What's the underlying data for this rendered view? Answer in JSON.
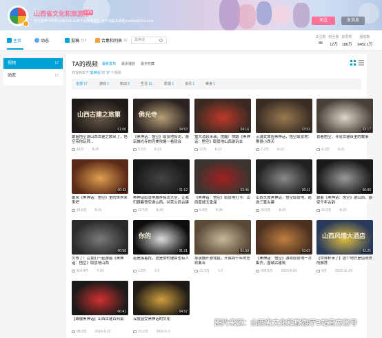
{
  "header": {
    "username": "山西省文化和旅游厅",
    "level": "LV6",
    "signature": "务注宣传守好地大美山西  山西文旅发布官方  合作请联系邮箱sxwhlyt@163.com",
    "follow_label": "关注",
    "message_label": "发消息"
  },
  "nav": {
    "items": [
      {
        "label": "主页",
        "count": ""
      },
      {
        "label": "动态",
        "count": ""
      },
      {
        "label": "投稿",
        "count": "613"
      },
      {
        "label": "合集和列表",
        "count": "22"
      }
    ],
    "search_value": "黑神话",
    "stats": [
      {
        "label": "关注数",
        "value": "86"
      },
      {
        "label": "粉丝数",
        "value": "12万"
      },
      {
        "label": "获赞数",
        "value": "186万"
      },
      {
        "label": "播放数",
        "value": "1482.1万"
      }
    ]
  },
  "sidebar": {
    "items": [
      {
        "label": "视频",
        "count": "17"
      },
      {
        "label": "动态",
        "count": "17"
      }
    ]
  },
  "main": {
    "title": "TA的视频",
    "sort_tabs": [
      "最新发布",
      "最多播放",
      "最多收藏"
    ],
    "result_prefix": "共找到关于“",
    "result_keyword": "黑神话",
    "result_mid": "”的 ",
    "result_count": "17",
    "result_suffix": " 个视频",
    "filters": [
      {
        "label": "全部",
        "count": "17"
      },
      {
        "label": "游戏",
        "count": "1"
      },
      {
        "label": "知识",
        "count": "2"
      },
      {
        "label": "生活",
        "count": "11"
      },
      {
        "label": "影视",
        "count": "1"
      },
      {
        "label": "资讯",
        "count": "1"
      },
      {
        "label": "美食",
        "count": "1"
      }
    ]
  },
  "videos": [
    {
      "thumb_text": "山西古建之旅第",
      "duration": "01:06",
      "title": "跟着悟空游山西古建之旅来了，悟空带你玩转...",
      "views": "16万",
      "date": "8-25",
      "bg": "#1e1a18",
      "accent": "#6a5a48"
    },
    {
      "thumb_text": "佛光寺",
      "duration": "04:53",
      "title": "《黑神话：悟空》取景地探访，游玩佛光寺的完美攻略一看就会",
      "views": "3.1万",
      "date": "8-23",
      "bg": "#2a2320",
      "accent": "#b8a078"
    },
    {
      "thumb_text": "",
      "duration": "04:16",
      "title": "重大消息来袭，提醒！快跟《黑神话：悟空》取景地山西游玩去",
      "views": "12万",
      "date": "8-22",
      "bg": "#3a2a22",
      "accent": "#c03a2a"
    },
    {
      "thumb_text": "",
      "duration": "03:53",
      "title": "沉浸式体验黑神话，悟空取景地：隰县小西天",
      "views": "2.2万",
      "date": "8-22",
      "bg": "#3a2e24",
      "accent": "#9a7a50"
    },
    {
      "thumb_text": "",
      "duration": "03:17",
      "title": "喜看悟空，寻觅古建筑里的故事",
      "views": "4.3万",
      "date": "8-21",
      "bg": "#4a4038",
      "accent": "#ddd5c8"
    },
    {
      "thumb_text": "",
      "duration": "00:43",
      "title": "跟来《黑神话：悟空》里的世界来来吧",
      "views": "15.6万",
      "date": "8-21",
      "bg": "#5a2a18",
      "accent": "#e0a050"
    },
    {
      "thumb_text": "",
      "duration": "01:12",
      "title": "黑神话取景地推荐探访大全，让我们跟着悟空游山西，共赏山西古建",
      "views": "22.5万",
      "date": "8-20",
      "bg": "#181818",
      "accent": "#444444"
    },
    {
      "thumb_text": "",
      "duration": "03:46",
      "title": "《黑神话：悟空》取景地打卡：山西晋城玉皇庙",
      "views": "5.8万",
      "date": "8-20",
      "bg": "#3a3530",
      "accent": "#a02020"
    },
    {
      "thumb_text": "",
      "duration": "00:11",
      "title": "山西文旅黑神话，悟空取景地，巡游三晋古建",
      "views": "20.6万",
      "date": "8-20",
      "bg": "#202020",
      "accent": "#8a8a8a"
    },
    {
      "thumb_text": "",
      "duration": "00:09",
      "title": "跟着《黑神话：悟空》游山西，感受千年古韵",
      "views": "31.5万",
      "date": "8-20",
      "bg": "#1a1a1a",
      "accent": "#9a9a9a"
    },
    {
      "thumb_text": "",
      "duration": "00:58",
      "title": "久等了！让我们一起游遍《黑神话：悟空》取景地山西",
      "views": "114.4万",
      "date": "7-20",
      "bg": "#2a2a2a",
      "accent": "#7a7a7a"
    },
    {
      "thumb_text": "你的",
      "duration": "01:21",
      "title": "若是接着找，这是你的理由也有人",
      "views": "1.8万",
      "date": "2-3",
      "bg": "#0e0e0e",
      "accent": "#dddddd"
    },
    {
      "thumb_text": "",
      "duration": "01:59",
      "title": "承承翻开游戏篇，开启两千年的悲欢离合",
      "views": "21.1万",
      "date": "1-2",
      "bg": "#5a4a38",
      "accent": "#c8b898"
    },
    {
      "thumb_text": "",
      "duration": "03:02",
      "title": "《黑神话：悟空》游戏取景地一次集齐，晋城古建筑",
      "views": "209.6万",
      "date": "2023-8-20",
      "bg": "#4a3020",
      "accent": "#c08040"
    },
    {
      "thumb_text": "山西风情大酒店",
      "duration": "02:25",
      "title": "【世界杯来了】这个地方是值得去的推荐",
      "views": "4万",
      "date": "2022-11-19",
      "bg": "#2a3a5a",
      "accent": "#e0c040"
    },
    {
      "thumb_text": "",
      "duration": "00:41",
      "title": "【致敬黑神话】山西古建百科篇",
      "views": "98.6万",
      "date": "2022-6-19",
      "bg": "#1a1a1a",
      "accent": "#d03030"
    },
    {
      "thumb_text": "",
      "duration": "04:57",
      "title": "深度感受黑神话的文化",
      "views": "10.2万",
      "date": "2022-1-1",
      "bg": "#1e1a16",
      "accent": "#d0a040"
    }
  ],
  "watermark": "图片来源：山西省文化和旅游厅B站官方账号"
}
